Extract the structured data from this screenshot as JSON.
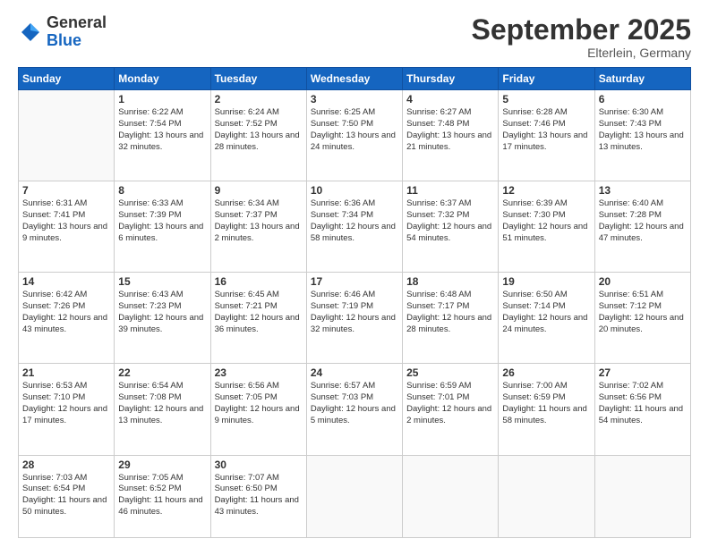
{
  "header": {
    "logo_general": "General",
    "logo_blue": "Blue",
    "month_title": "September 2025",
    "location": "Elterlein, Germany"
  },
  "days_of_week": [
    "Sunday",
    "Monday",
    "Tuesday",
    "Wednesday",
    "Thursday",
    "Friday",
    "Saturday"
  ],
  "weeks": [
    [
      {
        "day": "",
        "info": ""
      },
      {
        "day": "1",
        "info": "Sunrise: 6:22 AM\nSunset: 7:54 PM\nDaylight: 13 hours and 32 minutes."
      },
      {
        "day": "2",
        "info": "Sunrise: 6:24 AM\nSunset: 7:52 PM\nDaylight: 13 hours and 28 minutes."
      },
      {
        "day": "3",
        "info": "Sunrise: 6:25 AM\nSunset: 7:50 PM\nDaylight: 13 hours and 24 minutes."
      },
      {
        "day": "4",
        "info": "Sunrise: 6:27 AM\nSunset: 7:48 PM\nDaylight: 13 hours and 21 minutes."
      },
      {
        "day": "5",
        "info": "Sunrise: 6:28 AM\nSunset: 7:46 PM\nDaylight: 13 hours and 17 minutes."
      },
      {
        "day": "6",
        "info": "Sunrise: 6:30 AM\nSunset: 7:43 PM\nDaylight: 13 hours and 13 minutes."
      }
    ],
    [
      {
        "day": "7",
        "info": "Sunrise: 6:31 AM\nSunset: 7:41 PM\nDaylight: 13 hours and 9 minutes."
      },
      {
        "day": "8",
        "info": "Sunrise: 6:33 AM\nSunset: 7:39 PM\nDaylight: 13 hours and 6 minutes."
      },
      {
        "day": "9",
        "info": "Sunrise: 6:34 AM\nSunset: 7:37 PM\nDaylight: 13 hours and 2 minutes."
      },
      {
        "day": "10",
        "info": "Sunrise: 6:36 AM\nSunset: 7:34 PM\nDaylight: 12 hours and 58 minutes."
      },
      {
        "day": "11",
        "info": "Sunrise: 6:37 AM\nSunset: 7:32 PM\nDaylight: 12 hours and 54 minutes."
      },
      {
        "day": "12",
        "info": "Sunrise: 6:39 AM\nSunset: 7:30 PM\nDaylight: 12 hours and 51 minutes."
      },
      {
        "day": "13",
        "info": "Sunrise: 6:40 AM\nSunset: 7:28 PM\nDaylight: 12 hours and 47 minutes."
      }
    ],
    [
      {
        "day": "14",
        "info": "Sunrise: 6:42 AM\nSunset: 7:26 PM\nDaylight: 12 hours and 43 minutes."
      },
      {
        "day": "15",
        "info": "Sunrise: 6:43 AM\nSunset: 7:23 PM\nDaylight: 12 hours and 39 minutes."
      },
      {
        "day": "16",
        "info": "Sunrise: 6:45 AM\nSunset: 7:21 PM\nDaylight: 12 hours and 36 minutes."
      },
      {
        "day": "17",
        "info": "Sunrise: 6:46 AM\nSunset: 7:19 PM\nDaylight: 12 hours and 32 minutes."
      },
      {
        "day": "18",
        "info": "Sunrise: 6:48 AM\nSunset: 7:17 PM\nDaylight: 12 hours and 28 minutes."
      },
      {
        "day": "19",
        "info": "Sunrise: 6:50 AM\nSunset: 7:14 PM\nDaylight: 12 hours and 24 minutes."
      },
      {
        "day": "20",
        "info": "Sunrise: 6:51 AM\nSunset: 7:12 PM\nDaylight: 12 hours and 20 minutes."
      }
    ],
    [
      {
        "day": "21",
        "info": "Sunrise: 6:53 AM\nSunset: 7:10 PM\nDaylight: 12 hours and 17 minutes."
      },
      {
        "day": "22",
        "info": "Sunrise: 6:54 AM\nSunset: 7:08 PM\nDaylight: 12 hours and 13 minutes."
      },
      {
        "day": "23",
        "info": "Sunrise: 6:56 AM\nSunset: 7:05 PM\nDaylight: 12 hours and 9 minutes."
      },
      {
        "day": "24",
        "info": "Sunrise: 6:57 AM\nSunset: 7:03 PM\nDaylight: 12 hours and 5 minutes."
      },
      {
        "day": "25",
        "info": "Sunrise: 6:59 AM\nSunset: 7:01 PM\nDaylight: 12 hours and 2 minutes."
      },
      {
        "day": "26",
        "info": "Sunrise: 7:00 AM\nSunset: 6:59 PM\nDaylight: 11 hours and 58 minutes."
      },
      {
        "day": "27",
        "info": "Sunrise: 7:02 AM\nSunset: 6:56 PM\nDaylight: 11 hours and 54 minutes."
      }
    ],
    [
      {
        "day": "28",
        "info": "Sunrise: 7:03 AM\nSunset: 6:54 PM\nDaylight: 11 hours and 50 minutes."
      },
      {
        "day": "29",
        "info": "Sunrise: 7:05 AM\nSunset: 6:52 PM\nDaylight: 11 hours and 46 minutes."
      },
      {
        "day": "30",
        "info": "Sunrise: 7:07 AM\nSunset: 6:50 PM\nDaylight: 11 hours and 43 minutes."
      },
      {
        "day": "",
        "info": ""
      },
      {
        "day": "",
        "info": ""
      },
      {
        "day": "",
        "info": ""
      },
      {
        "day": "",
        "info": ""
      }
    ]
  ]
}
